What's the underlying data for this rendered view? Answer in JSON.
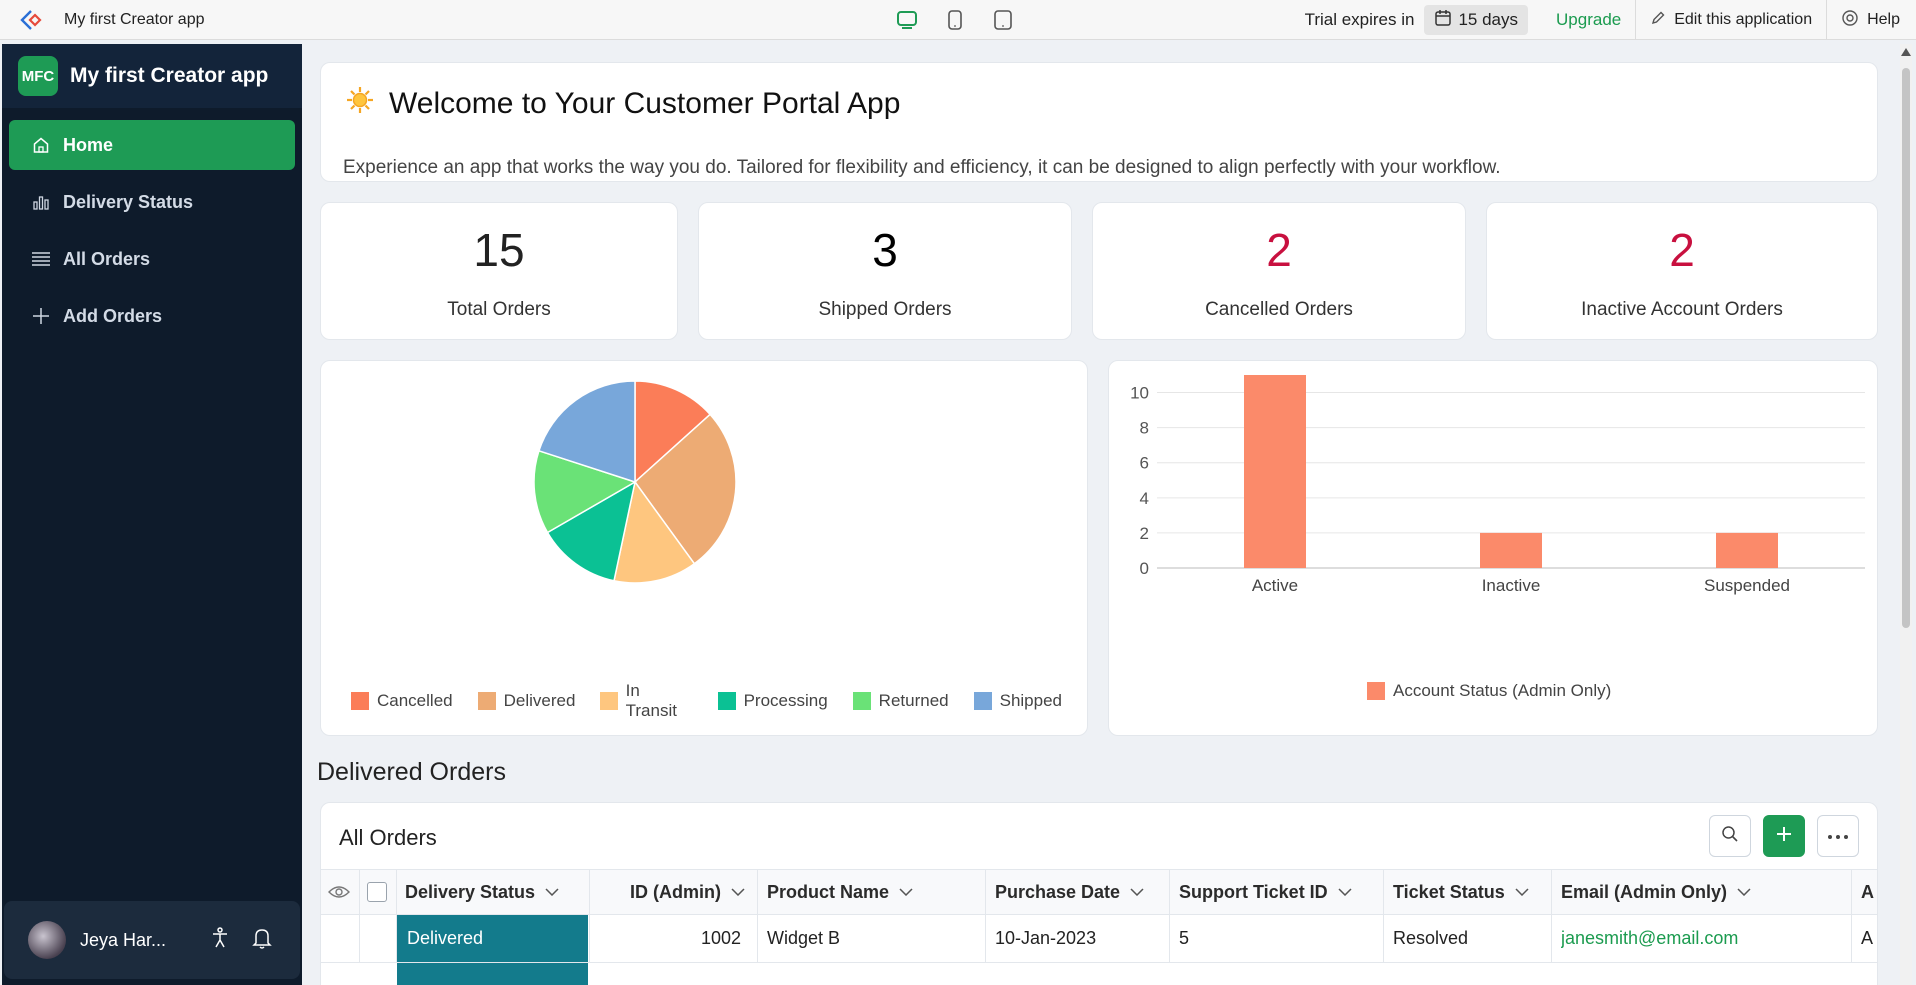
{
  "topbar": {
    "app_title": "My first Creator app",
    "trial_text": "Trial expires in",
    "trial_days": "15 days",
    "upgrade": "Upgrade",
    "edit_app": "Edit this application",
    "help": "Help"
  },
  "sidebar": {
    "badge": "MFC",
    "title": "My first Creator app",
    "items": [
      {
        "label": "Home",
        "icon": "home-icon",
        "active": true
      },
      {
        "label": "Delivery Status",
        "icon": "bar-chart-icon"
      },
      {
        "label": "All Orders",
        "icon": "list-icon"
      },
      {
        "label": "Add Orders",
        "icon": "plus-icon"
      }
    ],
    "user": "Jeya Har..."
  },
  "welcome": {
    "title": "Welcome to Your Customer Portal App",
    "subtitle": "Experience an app that works the way you do. Tailored for flexibility and efficiency, it can be designed to align perfectly with your workflow."
  },
  "stats": [
    {
      "value": "15",
      "label": "Total Orders",
      "color": "#222222"
    },
    {
      "value": "3",
      "label": "Shipped Orders",
      "color": "#000000"
    },
    {
      "value": "2",
      "label": "Cancelled Orders",
      "color": "#c8103f"
    },
    {
      "value": "2",
      "label": "Inactive Account Orders",
      "color": "#c8103f"
    }
  ],
  "chart_data": [
    {
      "type": "pie",
      "categories": [
        "Cancelled",
        "Delivered",
        "In Transit",
        "Processing",
        "Returned",
        "Shipped"
      ],
      "values": [
        2,
        4,
        2,
        2,
        2,
        3
      ],
      "colors": [
        "#fb7d58",
        "#edab74",
        "#fec67f",
        "#0bc194",
        "#6ae277",
        "#78a7da"
      ],
      "legend": "bottom"
    },
    {
      "type": "bar",
      "categories": [
        "Active",
        "Inactive",
        "Suspended"
      ],
      "series": [
        {
          "name": "Account Status (Admin Only)",
          "values": [
            11,
            2,
            2
          ]
        }
      ],
      "ylim": [
        0,
        11
      ],
      "yticks": [
        0,
        2,
        4,
        6,
        8,
        10
      ],
      "color": "#fb8a6a",
      "grid": true,
      "legend": "bottom"
    }
  ],
  "section": {
    "title": "Delivered Orders"
  },
  "table": {
    "title": "All Orders",
    "columns": [
      "Delivery Status",
      "ID (Admin)",
      "Product Name",
      "Purchase Date",
      "Support Ticket ID",
      "Ticket Status",
      "Email (Admin Only)",
      "A"
    ],
    "rows": [
      [
        "Delivered",
        "1002",
        "Widget B",
        "10-Jan-2023",
        "5",
        "Resolved",
        "janesmith@email.com",
        "A"
      ]
    ]
  }
}
